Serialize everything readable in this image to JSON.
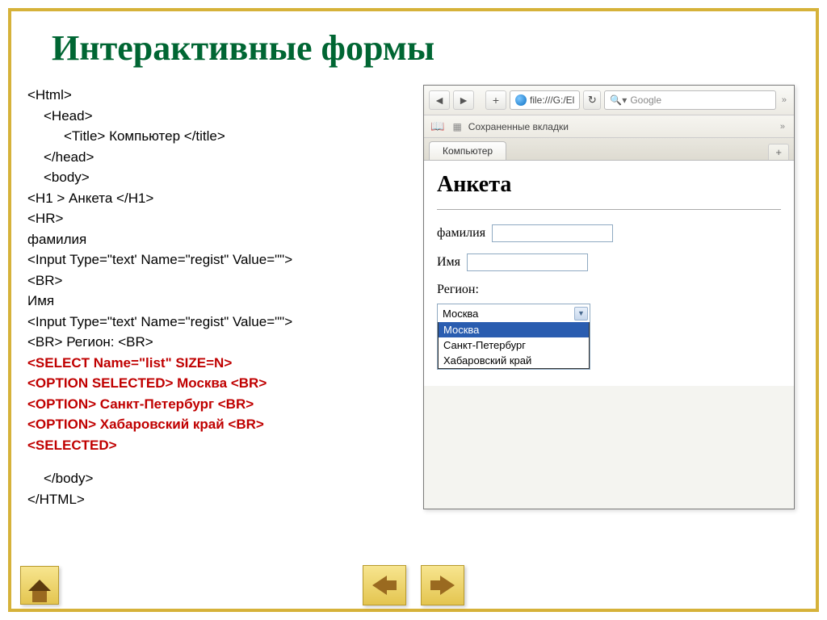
{
  "slide": {
    "title": "Интерактивные формы"
  },
  "code": {
    "l1": "<Html>",
    "l2": "<Head>",
    "l3": "<Title> Компьютер </title>",
    "l4": "</head>",
    "l5": "<body>",
    "l6": "<H1 > Анкета </H1>",
    "l7": "<HR>",
    "l8": "фамилия",
    "l9": "<Input Type=\"text' Name=\"regist\" Value=\"\">",
    "l10": "<BR>",
    "l11": "Имя",
    "l12": "<Input Type=\"text' Name=\"regist\" Value=\"\">",
    "l13": "<BR> Регион: <BR>",
    "l14": "<SELECT Name=\"list\" SIZE=N>",
    "l15": "<OPTION SELECTED> Москва <BR>",
    "l16": "<OPTION> Санкт-Петербург <BR>",
    "l17": "<OPTION> Хабаровский край <BR>",
    "l18": "<SELECTED>",
    "l19": "</body>",
    "l20": "</HTML>"
  },
  "browser": {
    "url": "file:///G:/El",
    "search_placeholder": "Google",
    "bookmarks_label": "Сохраненные вкладки",
    "tab_label": "Компьютер",
    "page": {
      "heading": "Анкета",
      "label_surname": "фамилия",
      "label_name": "Имя",
      "label_region": "Регион:",
      "select_value": "Москва",
      "options": [
        "Москва",
        "Санкт-Петербург",
        "Хабаровский край"
      ]
    }
  }
}
